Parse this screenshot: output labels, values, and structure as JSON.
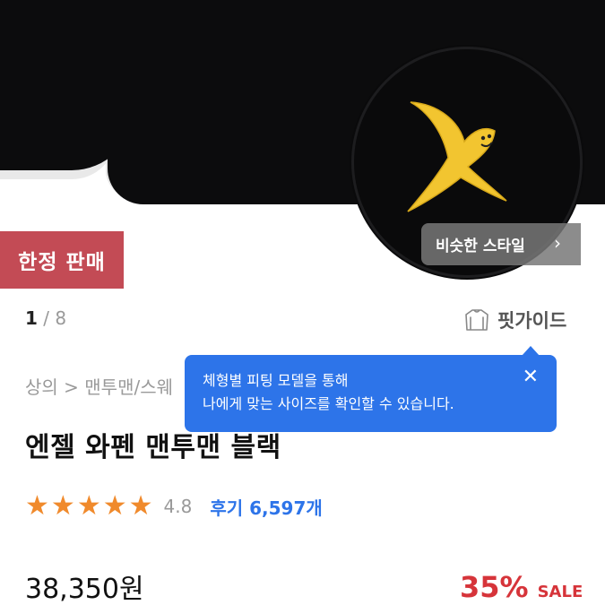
{
  "product_image": {
    "similar_style_label": "비슷한 스타일",
    "limited_badge": "한정 판매"
  },
  "pager": {
    "current": "1",
    "separator": " / ",
    "total": "8"
  },
  "fit_guide": {
    "label": "핏가이드",
    "icon": "sweatshirt-icon"
  },
  "breadcrumb": "상의 > 맨투맨/스웨",
  "tooltip": {
    "line1": "체형별 피팅 모델을 통해",
    "line2": "나에게 맞는 사이즈를 확인할 수 있습니다.",
    "close": "✕"
  },
  "product": {
    "title": "엔젤 와펜 맨투맨 블랙",
    "rating": "4.8",
    "stars": 5,
    "reviews": "후기 6,597개",
    "price": "38,350원",
    "discount_percent": "35%",
    "sale_label": "SALE"
  },
  "colors": {
    "badge": "#c34b55",
    "tooltip": "#2d74e9",
    "star": "#f08a2c",
    "discount": "#d6343a"
  }
}
